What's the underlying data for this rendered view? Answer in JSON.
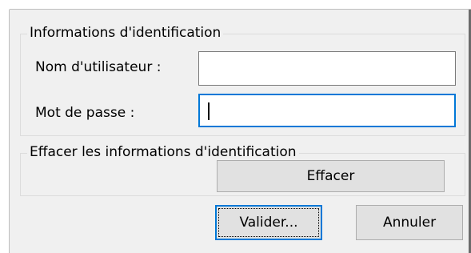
{
  "credentials_group": {
    "legend": "Informations d'identification",
    "username_label": "Nom d'utilisateur :",
    "username_value": "",
    "password_label": "Mot de passe :",
    "password_value": ""
  },
  "clear_group": {
    "legend": "Effacer les informations d'identification",
    "clear_button": "Effacer"
  },
  "actions": {
    "ok_button": "Valider...",
    "cancel_button": "Annuler"
  },
  "colors": {
    "focus_accent": "#0078d7",
    "background": "#f0f0f0"
  }
}
